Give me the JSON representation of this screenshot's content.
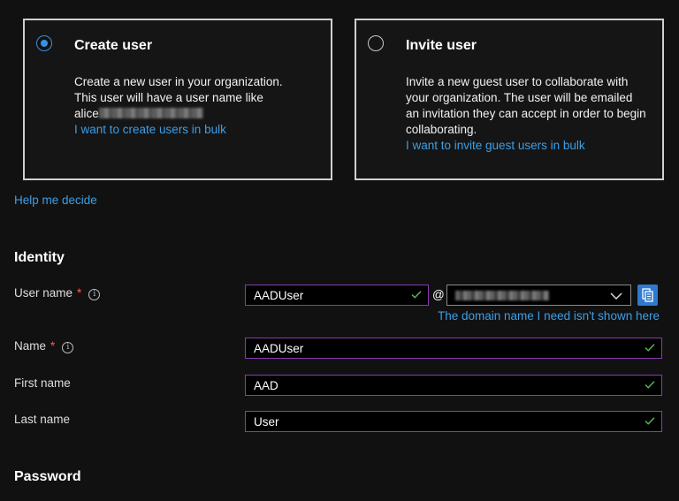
{
  "options": {
    "create": {
      "title": "Create user",
      "desc_line1": "Create a new user in your organization.",
      "desc_line2": "This user will have a user name like",
      "desc_prefix": "alice",
      "bulk_link": "I want to create users in bulk",
      "selected": true
    },
    "invite": {
      "title": "Invite user",
      "desc": "Invite a new guest user to collaborate with your organization. The user will be emailed an invitation they can accept in order to begin collaborating.",
      "bulk_link": "I want to invite guest users in bulk",
      "selected": false
    }
  },
  "help_link": "Help me decide",
  "identity": {
    "heading": "Identity",
    "username": {
      "label": "User name",
      "required_mark": "*",
      "info": "i",
      "value": "AADUser",
      "at": "@",
      "domain_link": "The domain name I need isn't shown here"
    },
    "name": {
      "label": "Name",
      "required_mark": "*",
      "info": "i",
      "value": "AADUser"
    },
    "first_name": {
      "label": "First name",
      "value": "AAD"
    },
    "last_name": {
      "label": "Last name",
      "value": "User"
    }
  },
  "password_heading": "Password",
  "colors": {
    "accent": "#3b8fe0",
    "link": "#3d9ee6",
    "field_border": "#8a3bb3",
    "valid": "#5db85b",
    "required": "#ff5a5a"
  },
  "icons": {
    "valid": "check-icon",
    "dropdown": "chevron-down-icon",
    "copy": "copy-icon",
    "info": "info-icon"
  }
}
